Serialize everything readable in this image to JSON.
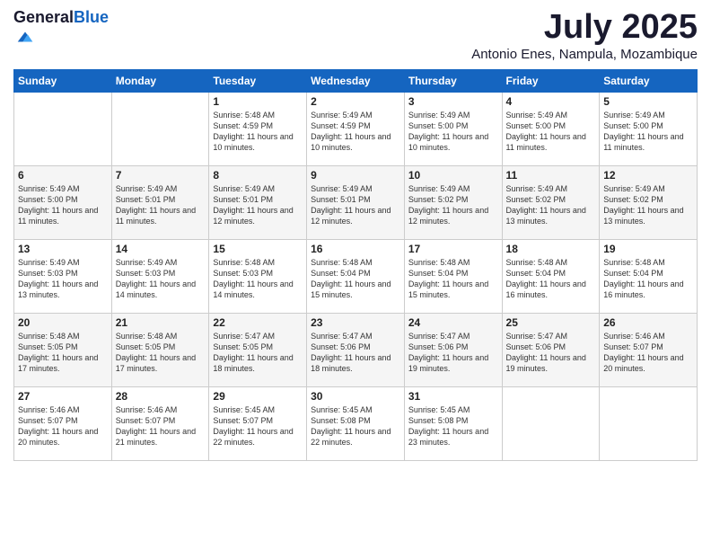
{
  "logo": {
    "general": "General",
    "blue": "Blue"
  },
  "title": "July 2025",
  "location": "Antonio Enes, Nampula, Mozambique",
  "days_header": [
    "Sunday",
    "Monday",
    "Tuesday",
    "Wednesday",
    "Thursday",
    "Friday",
    "Saturday"
  ],
  "weeks": [
    [
      {
        "day": "",
        "info": ""
      },
      {
        "day": "",
        "info": ""
      },
      {
        "day": "1",
        "info": "Sunrise: 5:48 AM\nSunset: 4:59 PM\nDaylight: 11 hours and 10 minutes."
      },
      {
        "day": "2",
        "info": "Sunrise: 5:49 AM\nSunset: 4:59 PM\nDaylight: 11 hours and 10 minutes."
      },
      {
        "day": "3",
        "info": "Sunrise: 5:49 AM\nSunset: 5:00 PM\nDaylight: 11 hours and 10 minutes."
      },
      {
        "day": "4",
        "info": "Sunrise: 5:49 AM\nSunset: 5:00 PM\nDaylight: 11 hours and 11 minutes."
      },
      {
        "day": "5",
        "info": "Sunrise: 5:49 AM\nSunset: 5:00 PM\nDaylight: 11 hours and 11 minutes."
      }
    ],
    [
      {
        "day": "6",
        "info": "Sunrise: 5:49 AM\nSunset: 5:00 PM\nDaylight: 11 hours and 11 minutes."
      },
      {
        "day": "7",
        "info": "Sunrise: 5:49 AM\nSunset: 5:01 PM\nDaylight: 11 hours and 11 minutes."
      },
      {
        "day": "8",
        "info": "Sunrise: 5:49 AM\nSunset: 5:01 PM\nDaylight: 11 hours and 12 minutes."
      },
      {
        "day": "9",
        "info": "Sunrise: 5:49 AM\nSunset: 5:01 PM\nDaylight: 11 hours and 12 minutes."
      },
      {
        "day": "10",
        "info": "Sunrise: 5:49 AM\nSunset: 5:02 PM\nDaylight: 11 hours and 12 minutes."
      },
      {
        "day": "11",
        "info": "Sunrise: 5:49 AM\nSunset: 5:02 PM\nDaylight: 11 hours and 13 minutes."
      },
      {
        "day": "12",
        "info": "Sunrise: 5:49 AM\nSunset: 5:02 PM\nDaylight: 11 hours and 13 minutes."
      }
    ],
    [
      {
        "day": "13",
        "info": "Sunrise: 5:49 AM\nSunset: 5:03 PM\nDaylight: 11 hours and 13 minutes."
      },
      {
        "day": "14",
        "info": "Sunrise: 5:49 AM\nSunset: 5:03 PM\nDaylight: 11 hours and 14 minutes."
      },
      {
        "day": "15",
        "info": "Sunrise: 5:48 AM\nSunset: 5:03 PM\nDaylight: 11 hours and 14 minutes."
      },
      {
        "day": "16",
        "info": "Sunrise: 5:48 AM\nSunset: 5:04 PM\nDaylight: 11 hours and 15 minutes."
      },
      {
        "day": "17",
        "info": "Sunrise: 5:48 AM\nSunset: 5:04 PM\nDaylight: 11 hours and 15 minutes."
      },
      {
        "day": "18",
        "info": "Sunrise: 5:48 AM\nSunset: 5:04 PM\nDaylight: 11 hours and 16 minutes."
      },
      {
        "day": "19",
        "info": "Sunrise: 5:48 AM\nSunset: 5:04 PM\nDaylight: 11 hours and 16 minutes."
      }
    ],
    [
      {
        "day": "20",
        "info": "Sunrise: 5:48 AM\nSunset: 5:05 PM\nDaylight: 11 hours and 17 minutes."
      },
      {
        "day": "21",
        "info": "Sunrise: 5:48 AM\nSunset: 5:05 PM\nDaylight: 11 hours and 17 minutes."
      },
      {
        "day": "22",
        "info": "Sunrise: 5:47 AM\nSunset: 5:05 PM\nDaylight: 11 hours and 18 minutes."
      },
      {
        "day": "23",
        "info": "Sunrise: 5:47 AM\nSunset: 5:06 PM\nDaylight: 11 hours and 18 minutes."
      },
      {
        "day": "24",
        "info": "Sunrise: 5:47 AM\nSunset: 5:06 PM\nDaylight: 11 hours and 19 minutes."
      },
      {
        "day": "25",
        "info": "Sunrise: 5:47 AM\nSunset: 5:06 PM\nDaylight: 11 hours and 19 minutes."
      },
      {
        "day": "26",
        "info": "Sunrise: 5:46 AM\nSunset: 5:07 PM\nDaylight: 11 hours and 20 minutes."
      }
    ],
    [
      {
        "day": "27",
        "info": "Sunrise: 5:46 AM\nSunset: 5:07 PM\nDaylight: 11 hours and 20 minutes."
      },
      {
        "day": "28",
        "info": "Sunrise: 5:46 AM\nSunset: 5:07 PM\nDaylight: 11 hours and 21 minutes."
      },
      {
        "day": "29",
        "info": "Sunrise: 5:45 AM\nSunset: 5:07 PM\nDaylight: 11 hours and 22 minutes."
      },
      {
        "day": "30",
        "info": "Sunrise: 5:45 AM\nSunset: 5:08 PM\nDaylight: 11 hours and 22 minutes."
      },
      {
        "day": "31",
        "info": "Sunrise: 5:45 AM\nSunset: 5:08 PM\nDaylight: 11 hours and 23 minutes."
      },
      {
        "day": "",
        "info": ""
      },
      {
        "day": "",
        "info": ""
      }
    ]
  ]
}
